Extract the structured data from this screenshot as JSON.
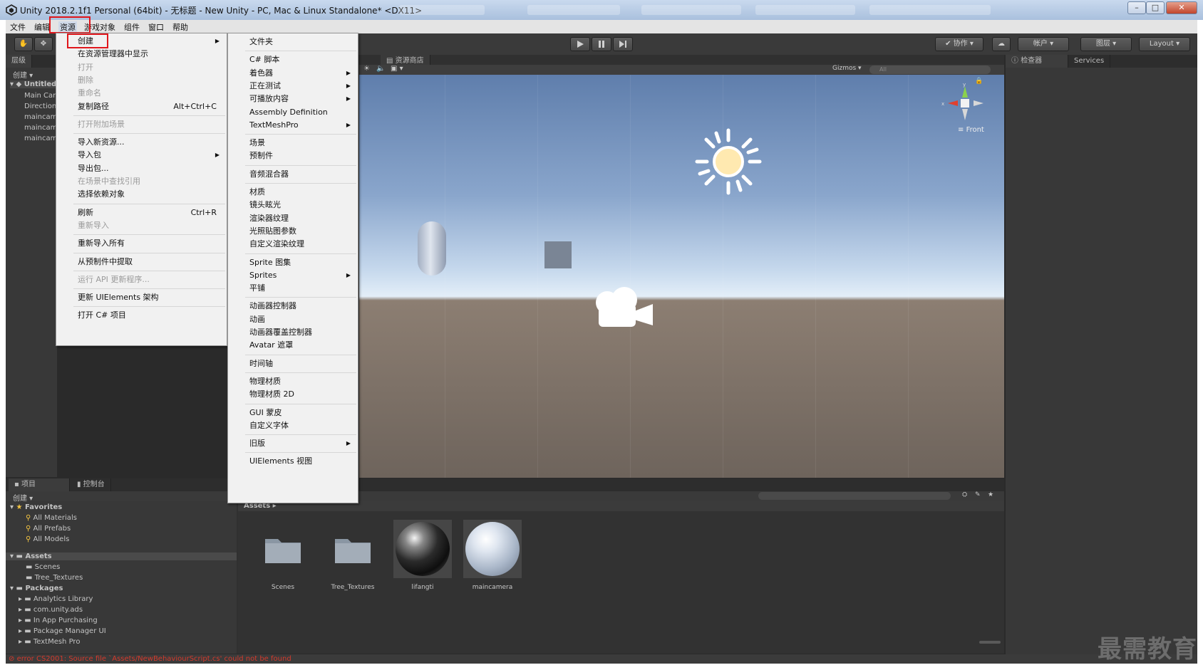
{
  "window": {
    "title": "Unity 2018.2.1f1 Personal (64bit) - 无标题 - New Unity - PC, Mac & Linux Standalone* <DX11>",
    "minimize": "–",
    "maximize": "□",
    "close": "✕"
  },
  "menubar": {
    "items": [
      "文件",
      "编辑",
      "资源",
      "游戏对象",
      "组件",
      "窗口",
      "帮助"
    ],
    "active": "资源"
  },
  "toolbar": {
    "collab": "协作",
    "account": "帐户",
    "layers": "图层",
    "layout": "Layout",
    "play_icon": "play-icon",
    "pause_icon": "pause-icon",
    "step_icon": "step-icon"
  },
  "hierarchy": {
    "tab": "层级",
    "create": "创建",
    "scene": "Untitled",
    "items": [
      "Main Car",
      "Direction",
      "maincam",
      "maincam",
      "maincam"
    ]
  },
  "scene_view": {
    "tab_asset_store": "资源商店",
    "gizmos": "Gizmos",
    "search_placeholder": "All",
    "orientation": "Front",
    "axis_x": "x",
    "axis_y": "y"
  },
  "inspector": {
    "tab_inspector": "检查器",
    "tab_services": "Services"
  },
  "project": {
    "tab_project": "项目",
    "tab_console": "控制台",
    "create": "创建",
    "favorites_label": "Favorites",
    "favorites": [
      "All Materials",
      "All Prefabs",
      "All Models"
    ],
    "assets_label": "Assets",
    "assets": [
      "Scenes",
      "Tree_Textures"
    ],
    "packages_label": "Packages",
    "packages": [
      "Analytics Library",
      "com.unity.ads",
      "In App Purchasing",
      "Package Manager UI",
      "TextMesh Pro"
    ],
    "breadcrumb": "Assets",
    "grid_items": [
      {
        "name": "Scenes",
        "kind": "folder"
      },
      {
        "name": "Tree_Textures",
        "kind": "folder"
      },
      {
        "name": "lifangti",
        "kind": "material-dark"
      },
      {
        "name": "maincamera",
        "kind": "material-light"
      }
    ]
  },
  "assets_menu": {
    "items": [
      {
        "label": "创建",
        "submenu": true,
        "highlight": true
      },
      {
        "label": "在资源管理器中显示"
      },
      {
        "label": "打开",
        "disabled": true
      },
      {
        "label": "删除",
        "disabled": true
      },
      {
        "label": "重命名",
        "disabled": true
      },
      {
        "label": "复制路径",
        "shortcut": "Alt+Ctrl+C"
      },
      {
        "sep": true
      },
      {
        "label": "打开附加场景",
        "disabled": true
      },
      {
        "sep": true
      },
      {
        "label": "导入新资源..."
      },
      {
        "label": "导入包",
        "submenu": true
      },
      {
        "label": "导出包..."
      },
      {
        "label": "在场景中查找引用",
        "disabled": true
      },
      {
        "label": "选择依赖对象"
      },
      {
        "sep": true
      },
      {
        "label": "刷新",
        "shortcut": "Ctrl+R"
      },
      {
        "label": "重新导入",
        "disabled": true
      },
      {
        "sep": true
      },
      {
        "label": "重新导入所有"
      },
      {
        "sep": true
      },
      {
        "label": "从预制件中提取"
      },
      {
        "sep": true
      },
      {
        "label": "运行 API 更新程序...",
        "disabled": true
      },
      {
        "sep": true
      },
      {
        "label": "更新 UIElements 架构"
      },
      {
        "sep": true
      },
      {
        "label": "打开 C# 项目"
      }
    ]
  },
  "create_menu": {
    "items": [
      {
        "label": "文件夹"
      },
      {
        "sep": true
      },
      {
        "label": "C# 脚本"
      },
      {
        "label": "着色器",
        "submenu": true
      },
      {
        "label": "正在测试",
        "submenu": true
      },
      {
        "label": "可播放内容",
        "submenu": true
      },
      {
        "label": "Assembly Definition"
      },
      {
        "label": "TextMeshPro",
        "submenu": true
      },
      {
        "sep": true
      },
      {
        "label": "场景"
      },
      {
        "label": "预制件"
      },
      {
        "sep": true
      },
      {
        "label": "音频混合器"
      },
      {
        "sep": true
      },
      {
        "label": "材质"
      },
      {
        "label": "镜头眩光"
      },
      {
        "label": "渲染器纹理"
      },
      {
        "label": "光照贴图参数"
      },
      {
        "label": "自定义渲染纹理"
      },
      {
        "sep": true
      },
      {
        "label": "Sprite 图集"
      },
      {
        "label": "Sprites",
        "submenu": true
      },
      {
        "label": "平铺"
      },
      {
        "sep": true
      },
      {
        "label": "动画器控制器"
      },
      {
        "label": "动画"
      },
      {
        "label": "动画器覆盖控制器"
      },
      {
        "label": "Avatar 遮罩"
      },
      {
        "sep": true
      },
      {
        "label": "时间轴"
      },
      {
        "sep": true
      },
      {
        "label": "物理材质"
      },
      {
        "label": "物理材质 2D"
      },
      {
        "sep": true
      },
      {
        "label": "GUI 蒙皮"
      },
      {
        "label": "自定义字体"
      },
      {
        "sep": true
      },
      {
        "label": "旧版",
        "submenu": true
      },
      {
        "sep": true
      },
      {
        "label": "UIElements 视图"
      }
    ]
  },
  "status": {
    "error": "error CS2001: Source file `Assets/NewBehaviourScript.cs' could not be found"
  },
  "watermark": "最需教育",
  "colors": {
    "highlight_box": "#e0161b",
    "editor_bg": "#2a2a2a",
    "menu_bg": "#f1f1f1"
  }
}
